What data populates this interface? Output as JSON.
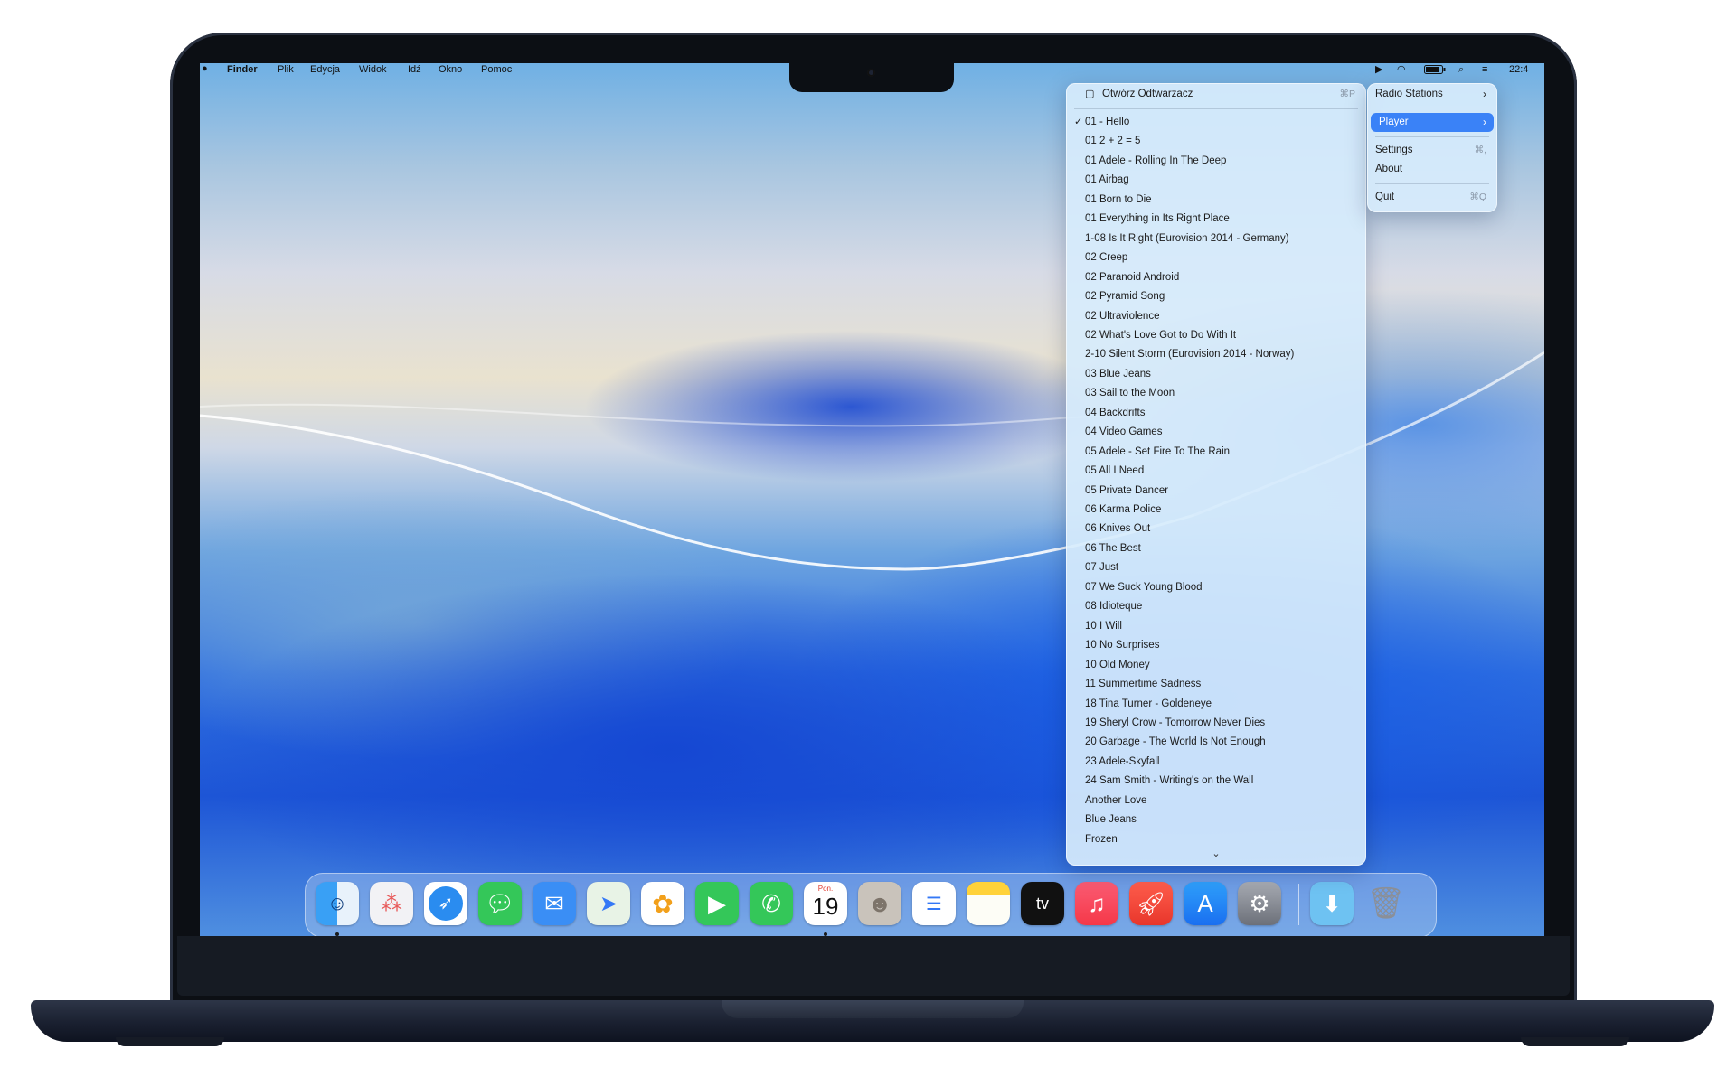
{
  "menubar": {
    "app": "Finder",
    "items": [
      "Plik",
      "Edycja",
      "Widok",
      "Idź",
      "Okno",
      "Pomoc"
    ],
    "clock": "22:4"
  },
  "player_menu": {
    "header": "Otwórz Odtwarzacz",
    "header_shortcut": "⌘P",
    "selected_track": "01 - Hello",
    "tracks": [
      "01 - Hello",
      "01 2 + 2 = 5",
      "01 Adele - Rolling In The Deep",
      "01 Airbag",
      "01 Born to Die",
      "01 Everything in Its Right Place",
      "1-08 Is It Right (Eurovision 2014 - Germany)",
      "02 Creep",
      "02 Paranoid Android",
      "02 Pyramid Song",
      "02 Ultraviolence",
      "02 What's Love Got to Do With It",
      "2-10 Silent Storm (Eurovision 2014 - Norway)",
      "03 Blue Jeans",
      "03 Sail to the Moon",
      "04 Backdrifts",
      "04 Video Games",
      "05 Adele - Set Fire To The Rain",
      "05 All I Need",
      "05 Private Dancer",
      "06 Karma Police",
      "06 Knives Out",
      "06 The Best",
      "07 Just",
      "07 We Suck Young Blood",
      "08 Idioteque",
      "10 I Will",
      "10 No Surprises",
      "10 Old Money",
      "11 Summertime Sadness",
      "18 Tina Turner - Goldeneye",
      "19 Sheryl Crow - Tomorrow Never Dies",
      "20 Garbage - The World Is Not Enough",
      "23 Adele-Skyfall",
      "24 Sam Smith - Writing's on the Wall",
      "Another Love",
      "Blue Jeans",
      "Frozen"
    ],
    "scroll_more": "⌄"
  },
  "main_menu": {
    "radio_stations": "Radio Stations",
    "player": "Player",
    "settings": "Settings",
    "settings_shortcut": "⌘,",
    "about": "About",
    "quit": "Quit",
    "quit_shortcut": "⌘Q"
  },
  "dock": {
    "calendar_day_label": "Pon.",
    "calendar_day_number": "19",
    "tv_label": "tv",
    "icons": [
      "finder",
      "launchpad",
      "safari",
      "messages",
      "mail",
      "maps",
      "photos",
      "facetime",
      "phone",
      "calendar",
      "contacts",
      "reminders",
      "notes",
      "apple-tv",
      "music",
      "rocket",
      "app-store",
      "system-settings",
      "downloads",
      "trash"
    ]
  }
}
